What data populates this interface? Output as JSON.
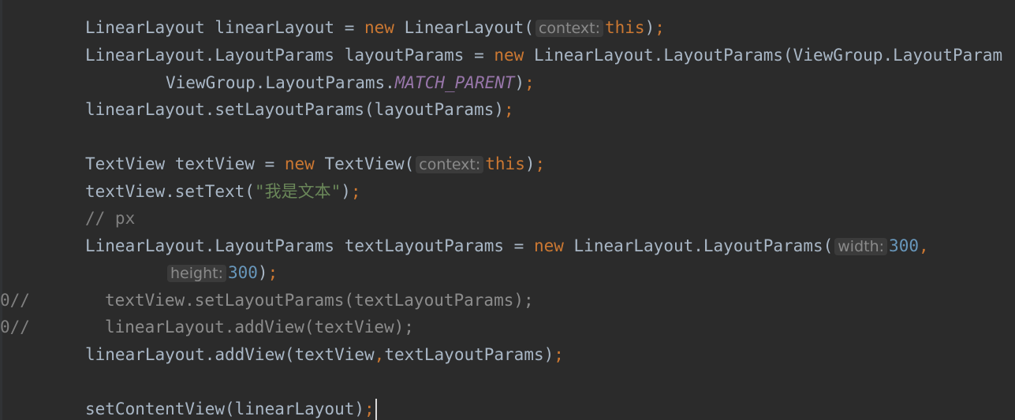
{
  "code": {
    "l1": {
      "t1": "LinearLayout linearLayout = ",
      "kw_new": "new",
      "t2": " LinearLayout(",
      "hint_context": "context:",
      "kw_this": "this",
      "t3": ")",
      "semi": ";"
    },
    "l2": {
      "t1": "LinearLayout.LayoutParams layoutParams = ",
      "kw_new": "new",
      "t2": " LinearLayout.LayoutParams(ViewGroup.LayoutParam"
    },
    "l3": {
      "t1": "ViewGroup.LayoutParams.",
      "const": "MATCH_PARENT",
      "t2": ")",
      "semi": ";"
    },
    "l4": {
      "t1": "linearLayout.setLayoutParams(layoutParams)",
      "semi": ";"
    },
    "l5": {
      "t1": "TextView textView = ",
      "kw_new": "new",
      "t2": " TextView(",
      "hint_context": "context:",
      "kw_this": "this",
      "t3": ")",
      "semi": ";"
    },
    "l6": {
      "t1": "textView.setText(",
      "str": "\"我是文本\"",
      "t2": ")",
      "semi": ";"
    },
    "l7": {
      "comment": "// px"
    },
    "l8": {
      "t1": "LinearLayout.LayoutParams textLayoutParams = ",
      "kw_new": "new",
      "t2": " LinearLayout.LayoutParams(",
      "hint_width": "width:",
      "num": "300",
      "comma": ","
    },
    "l9": {
      "hint_height": "height:",
      "num": "300",
      "t1": ")",
      "semi": ";"
    },
    "l10": {
      "prefix": "0//",
      "t1": "textView.setLayoutParams(textLayoutParams);"
    },
    "l11": {
      "prefix": "0//",
      "t1": "linearLayout.addView(textView);"
    },
    "l12": {
      "t1": "linearLayout.addView(textView",
      "comma": ",",
      "t2": "textLayoutParams)",
      "semi": ";"
    },
    "l13": {
      "t1": "setContentView(linearLayout)",
      "semi": ";"
    }
  },
  "colors": {
    "background": "#2b2b2b",
    "keyword": "#cc7832",
    "number": "#6897bb",
    "string": "#6a8759",
    "constant": "#9876aa",
    "comment": "#808080",
    "default": "#a9b7c6"
  }
}
